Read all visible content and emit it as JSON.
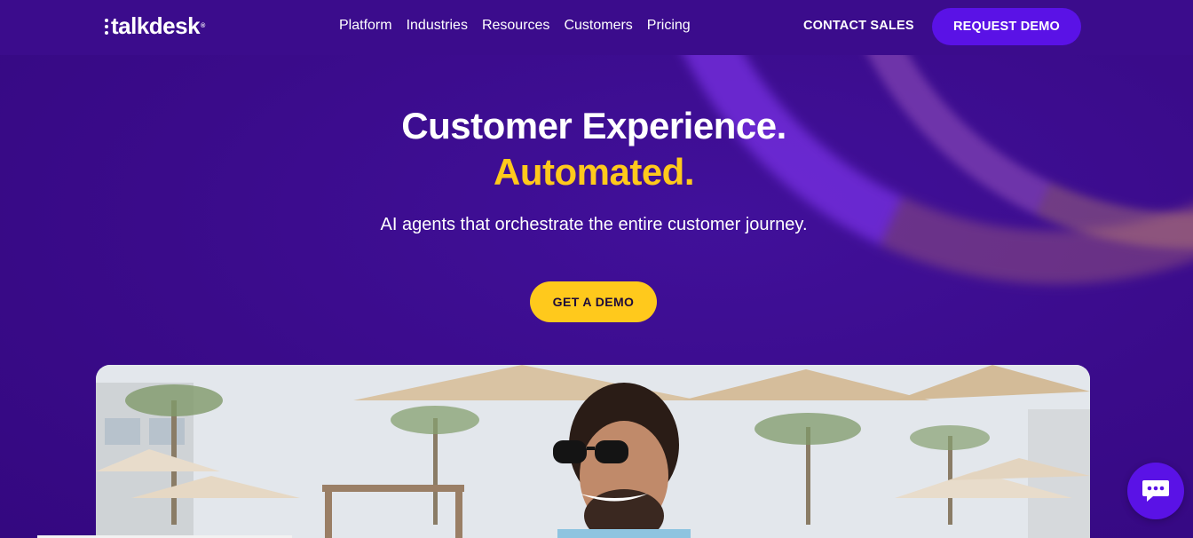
{
  "brand": {
    "name": "talkdesk",
    "mark": "®"
  },
  "nav": {
    "links": [
      {
        "label": "Platform"
      },
      {
        "label": "Industries"
      },
      {
        "label": "Resources"
      },
      {
        "label": "Customers"
      },
      {
        "label": "Pricing"
      }
    ],
    "contact_sales": "CONTACT SALES",
    "request_demo": "REQUEST DEMO"
  },
  "hero": {
    "title": "Customer Experience.",
    "accent": "Automated.",
    "subtitle": "AI agents that orchestrate the entire customer journey.",
    "cta": "GET A DEMO"
  },
  "colors": {
    "background": "#3c0a8e",
    "accent_yellow": "#ffc91c",
    "button_purple": "#5a12e6"
  },
  "icons": {
    "chat": "chat-bubble-icon"
  }
}
